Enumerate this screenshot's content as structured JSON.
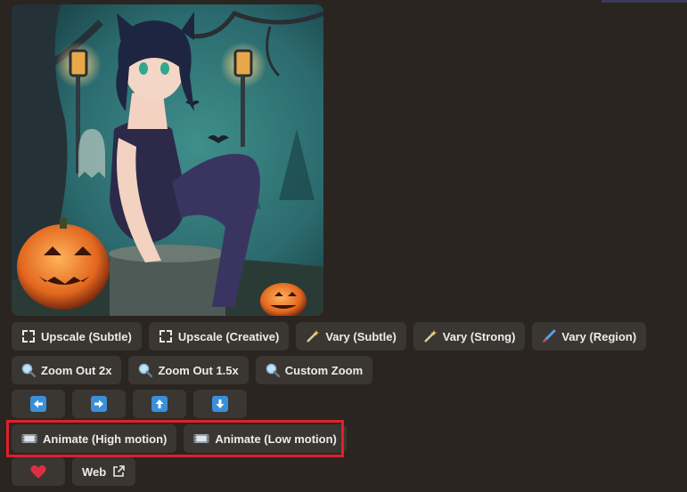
{
  "image": {
    "alt": ""
  },
  "row1": [
    {
      "label": "Upscale (Subtle)",
      "icon": "expand-icon"
    },
    {
      "label": "Upscale (Creative)",
      "icon": "expand-icon"
    },
    {
      "label": "Vary (Subtle)",
      "icon": "magic-wand-icon"
    },
    {
      "label": "Vary (Strong)",
      "icon": "magic-wand-icon"
    },
    {
      "label": "Vary (Region)",
      "icon": "paintbrush-icon"
    }
  ],
  "row2": [
    {
      "label": "Zoom Out 2x",
      "icon": "magnifier-icon"
    },
    {
      "label": "Zoom Out 1.5x",
      "icon": "magnifier-icon"
    },
    {
      "label": "Custom Zoom",
      "icon": "magnifier-icon"
    }
  ],
  "row3": [
    {
      "icon": "arrow-left-icon"
    },
    {
      "icon": "arrow-right-icon"
    },
    {
      "icon": "arrow-up-icon"
    },
    {
      "icon": "arrow-down-icon"
    }
  ],
  "row4": [
    {
      "label": "Animate (High motion)",
      "icon": "film-icon"
    },
    {
      "label": "Animate (Low motion)",
      "icon": "film-icon"
    }
  ],
  "row5": {
    "like_icon": "heart-icon",
    "web_label": "Web",
    "web_icon": "external-link-icon"
  },
  "colors": {
    "background": "#2a2521",
    "button": "#3a3631",
    "highlight": "#e0202a",
    "arrow_blue": "#3a8fd9",
    "heart": "#dd2e44"
  }
}
